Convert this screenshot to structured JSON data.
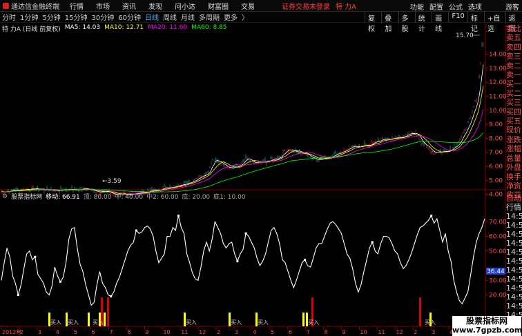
{
  "menubar": {
    "app_title": "通达信金融终端",
    "items": [
      "行情",
      "市场",
      "资讯",
      "发现",
      "问小达",
      "财富圈",
      "交易"
    ],
    "alert": "证券交易未登录",
    "stock": "特 力A",
    "right": [
      "功能",
      "配置",
      "公式",
      "选项",
      "游客"
    ]
  },
  "toolbar": {
    "periods": [
      "分时",
      "1分钟",
      "5分钟",
      "15分钟",
      "30分钟",
      "60分钟",
      "日线",
      "周线",
      "月线",
      "多周期",
      "更多"
    ],
    "more_arrow": "〉",
    "selected": "日线",
    "right_buttons": [
      "复权",
      "叠加",
      "多股",
      "统计",
      "画线",
      "F10",
      "标记",
      "+自选",
      "返回"
    ]
  },
  "legend": {
    "title": "特 力A",
    "subtitle": "(日线 前复权)",
    "ma5": "MA5: 14.03",
    "ma10": "MA10: 12.71",
    "ma20": "MA20: 11.60",
    "ma60": "MA60: 8.85",
    "colors": {
      "ma5": "#ffffff",
      "ma10": "#ffff00",
      "ma20": "#ff00ff",
      "ma60": "#00ff00"
    }
  },
  "price_axis": {
    "ticks": [
      "14.00",
      "13.00",
      "12.00",
      "11.00",
      "10.00",
      "9.00",
      "8.00",
      "7.00",
      "6.00",
      "5.00",
      "4.00"
    ],
    "max_label": "15.70",
    "min_label": "3.59",
    "range": [
      3.59,
      15.7
    ]
  },
  "indicator": {
    "name": "股票指标网",
    "move_label": "移动: 66.91",
    "levels": [
      "顶: 80.00",
      "中: 40.00",
      "中2: 60.00",
      "底: 20.00",
      "底1: 10.00"
    ],
    "current_value": "36.44",
    "ticks": [
      "70.00",
      "60.00",
      "50.00",
      "30.00",
      "20.00"
    ],
    "buy_label": "买入",
    "series_values": [
      30,
      42,
      52,
      46,
      33,
      28,
      20,
      27,
      38,
      48,
      50,
      44,
      46,
      34,
      31,
      28,
      22,
      20,
      26,
      39,
      33,
      29,
      32,
      42,
      58,
      65,
      66,
      52,
      41,
      36,
      27,
      20,
      13,
      15,
      27,
      36,
      28,
      25,
      20,
      19,
      22,
      28,
      32,
      38,
      44,
      50,
      54,
      56,
      64,
      62,
      63,
      66,
      67,
      65,
      60,
      50,
      42,
      45,
      48,
      60,
      60,
      66,
      64,
      74,
      66,
      62,
      48,
      42,
      35,
      31,
      30,
      39,
      50,
      56,
      50,
      58,
      70,
      66,
      62,
      55,
      52,
      55,
      56,
      48,
      43,
      48,
      51,
      62,
      60,
      56,
      52,
      45,
      40,
      43,
      48,
      56,
      64,
      66,
      62,
      55,
      44,
      42,
      36,
      30,
      25,
      30,
      36,
      42,
      44,
      40,
      39,
      45,
      52,
      55,
      55,
      60,
      65,
      69,
      70,
      68,
      65,
      62,
      55,
      48,
      45,
      38,
      28,
      22,
      27,
      36,
      44,
      52,
      56,
      50,
      48,
      55,
      60,
      60,
      59,
      55,
      50,
      48,
      42,
      38,
      40,
      44,
      49,
      55,
      61,
      66,
      67,
      69,
      71,
      74,
      69,
      72,
      64,
      56,
      62,
      50,
      43,
      30,
      22,
      16,
      14,
      18,
      22,
      34,
      46,
      56,
      62,
      66,
      72
    ]
  },
  "side_panel": [
    "委比",
    "卖五",
    "卖四",
    "卖三",
    "卖二",
    "卖一",
    "买一",
    "买二",
    "买三",
    "买四",
    "买五",
    "现价",
    "涨跌",
    "涨幅",
    "总量",
    "外盘",
    "换手",
    "净资",
    "收益"
  ],
  "side_panel2": [
    "自动",
    "行情",
    "14:5",
    "14:5",
    "14:5",
    "14:5",
    "14:5",
    "14:5",
    "14:5",
    "14:5",
    "14:5",
    "14:5",
    "14:5",
    "14:5"
  ],
  "date_axis": {
    "labels": [
      "2012年",
      "2",
      "3",
      "4",
      "5",
      "6",
      "7",
      "8",
      "9",
      "10",
      "11",
      "12",
      "2",
      "3",
      "4",
      "5",
      "6",
      "7",
      "8",
      "9",
      "10",
      "11",
      "12",
      "2",
      "3",
      "4",
      "5"
    ]
  },
  "watermark": {
    "line1": "股票指标网",
    "line2": "www.7gpzb.com"
  }
}
